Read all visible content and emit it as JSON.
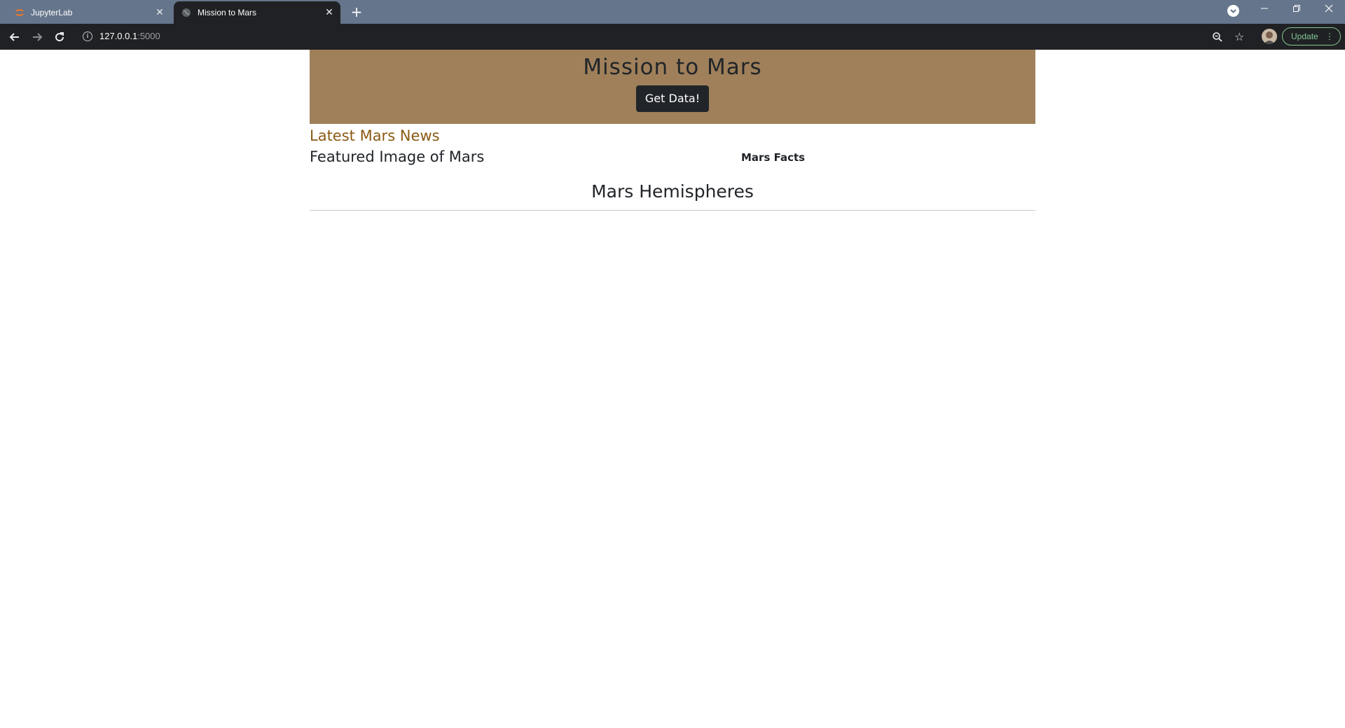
{
  "browser": {
    "tabs": [
      {
        "title": "JupyterLab",
        "favicon": "jupyter-logo-icon",
        "active": false
      },
      {
        "title": "Mission to Mars",
        "favicon": "globe-icon",
        "active": true
      }
    ],
    "new_tab_label": "+",
    "address": {
      "host": "127.0.0.1",
      "port": ":5000"
    },
    "update_label": "Update",
    "icons": {
      "back": "back-arrow-icon",
      "forward": "forward-arrow-icon",
      "reload": "reload-icon",
      "site_info": "info-icon",
      "zoom": "zoom-icon",
      "bookmark": "star-icon",
      "profile": "avatar",
      "menu": "kebab-menu-icon",
      "tab_search": "tab-search-icon",
      "minimize": "minimize-icon",
      "restore": "restore-icon",
      "close_window": "close-icon"
    },
    "colors": {
      "tabstrip": "#65758b",
      "toolbar": "#202124",
      "update_accent": "#81c995"
    }
  },
  "page": {
    "header": {
      "title": "Mission to Mars",
      "button_label": "Get Data!"
    },
    "news": {
      "heading": "Latest Mars News"
    },
    "featured": {
      "heading": "Featured Image of Mars"
    },
    "facts": {
      "heading": "Mars Facts"
    },
    "hemispheres": {
      "heading": "Mars Hemispheres"
    },
    "colors": {
      "jumbotron": "#9f805a",
      "news_heading": "#8b5a14",
      "text": "#212529"
    }
  }
}
